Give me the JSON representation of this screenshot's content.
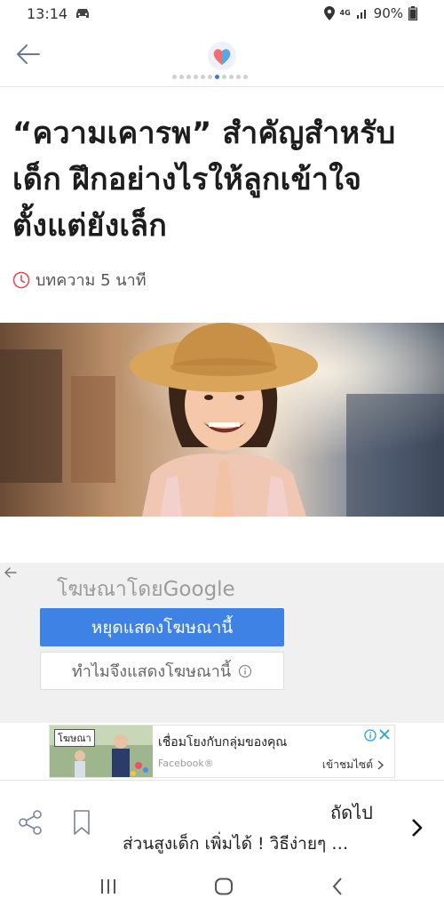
{
  "status_bar": {
    "time": "13:14",
    "network": "4G",
    "battery": "90%",
    "icons": [
      "car-icon",
      "location-icon",
      "signal-icon",
      "battery-icon"
    ]
  },
  "header": {
    "back_icon": "arrow-left-icon",
    "logo_icon": "heart-logo-icon",
    "page_dots": 11,
    "active_dot_index": 6
  },
  "article": {
    "title": "“ความเคารพ” สำคัญสำหรับเด็ก ฝึกอย่างไรให้ลูกเข้าใจตั้งแต่ยังเล็ก",
    "read_time": "บทความ 5 นาที",
    "read_time_icon": "clock-icon",
    "hero_image": "photo of smiling girl in straw hat with hands pressed together"
  },
  "ad": {
    "ads_by": "โฆษณาโดยGoogle",
    "stop_button": "หยุดแสดงโฆษณานี้",
    "why_button": "ทำไมจึงแสดงโฆษณานี้",
    "banner": {
      "tag": "โฆษณา",
      "title": "เชื่อมโยงกับกลุ่มของคุณ",
      "source": "Facebook®",
      "visit": "เข้าชมไซต์"
    }
  },
  "bottom_nav": {
    "next_label": "ถัดไป",
    "next_title": "ส่วนสูงเด็ก เพิ่มได้ ! วิธีง่ายๆ …"
  },
  "colors": {
    "accent_blue": "#3f82e6",
    "active_dot": "#3a78d8",
    "clock_red": "#e05050",
    "ad_background": "#f0f0f0"
  }
}
